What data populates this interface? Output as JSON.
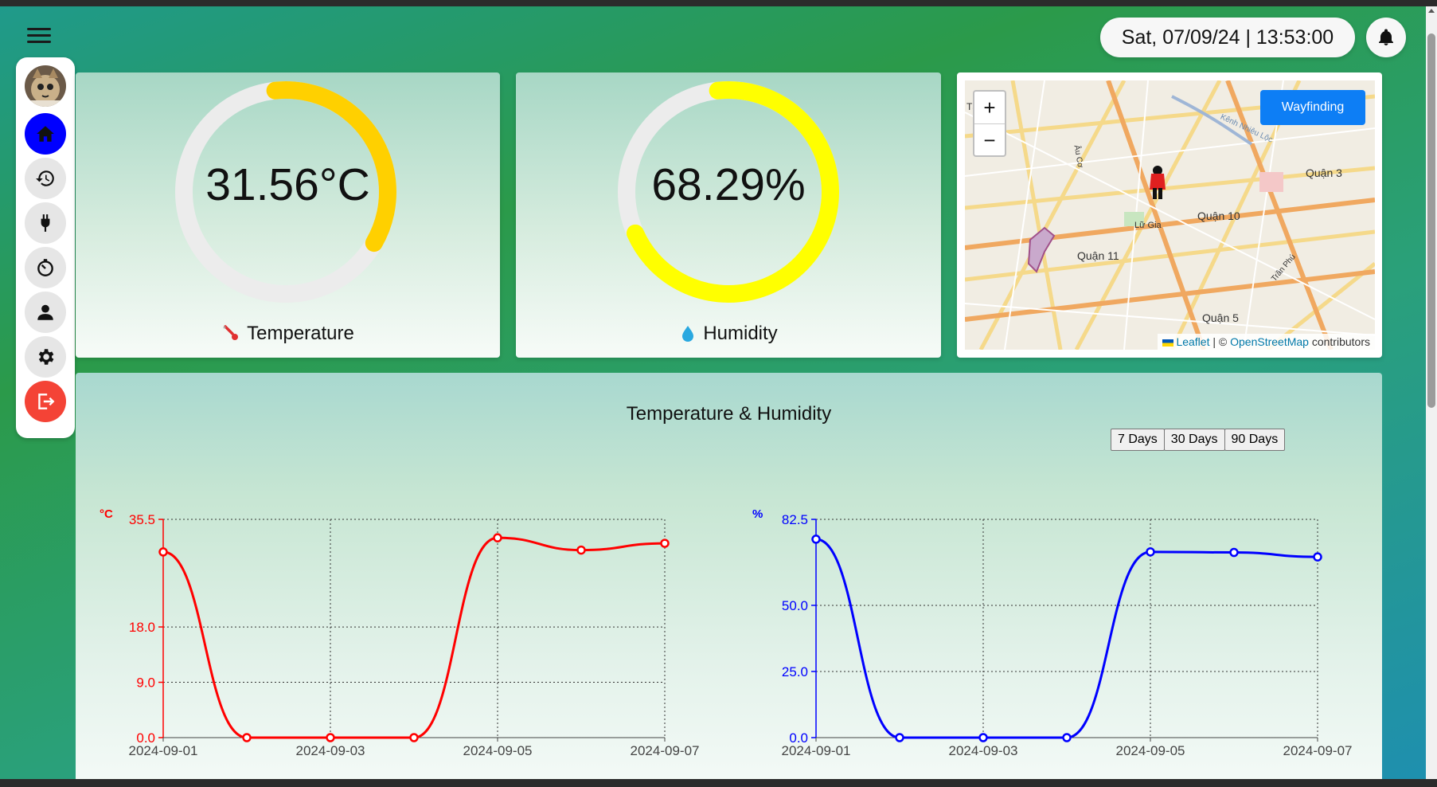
{
  "header": {
    "datetime": "Sat, 07/09/24  |  13:53:00"
  },
  "sidebar": {
    "items": [
      {
        "name": "home-icon",
        "active": true
      },
      {
        "name": "history-icon"
      },
      {
        "name": "plug-icon"
      },
      {
        "name": "timer-icon"
      },
      {
        "name": "user-icon"
      },
      {
        "name": "gear-icon"
      },
      {
        "name": "logout-icon"
      }
    ]
  },
  "temperature": {
    "value": "31.56°C",
    "label": "Temperature",
    "fill": 0.35,
    "color": "#ffd000"
  },
  "humidity": {
    "value": "68.29%",
    "label": "Humidity",
    "fill": 0.7,
    "color": "#ffff00"
  },
  "map": {
    "wayfinding_label": "Wayfinding",
    "zoom_in": "+",
    "zoom_out": "−",
    "attribution_leaflet": "Leaflet",
    "attribution_sep": "| ©",
    "attribution_osm": "OpenStreetMap",
    "attribution_tail": "contributors",
    "labels": [
      "Quận 3",
      "Quận 10",
      "Quận 11",
      "Quận 5",
      "Lữ Gia",
      "Trần Phú",
      "Âu Cơ",
      "Kênh Nhiêu Lộc",
      "Tâ"
    ]
  },
  "chart_section": {
    "title": "Temperature & Humidity",
    "range_buttons": [
      "7 Days",
      "30 Days",
      "90 Days"
    ]
  },
  "chart_data": [
    {
      "type": "line",
      "ylabel": "°C",
      "x": [
        "2024-09-01",
        "2024-09-02",
        "2024-09-03",
        "2024-09-04",
        "2024-09-05",
        "2024-09-06",
        "2024-09-07"
      ],
      "x_tick_labels": [
        "2024-09-01",
        "2024-09-03",
        "2024-09-05",
        "2024-09-07"
      ],
      "y_ticks": [
        0.0,
        9.0,
        18.0,
        35.5
      ],
      "y_tick_labels": [
        "0.0",
        "9.0",
        "18.0",
        "35.5"
      ],
      "ylim": [
        0,
        35.5
      ],
      "series": [
        {
          "values": [
            30.2,
            0.0,
            0.0,
            0.0,
            32.5,
            30.5,
            31.6
          ],
          "color": "#ff0000"
        }
      ],
      "grid": true
    },
    {
      "type": "line",
      "ylabel": "%",
      "x": [
        "2024-09-01",
        "2024-09-02",
        "2024-09-03",
        "2024-09-04",
        "2024-09-05",
        "2024-09-06",
        "2024-09-07"
      ],
      "x_tick_labels": [
        "2024-09-01",
        "2024-09-03",
        "2024-09-05",
        "2024-09-07"
      ],
      "y_ticks": [
        0.0,
        25.0,
        50.0,
        82.5
      ],
      "y_tick_labels": [
        "0.0",
        "25.0",
        "50.0",
        "82.5"
      ],
      "ylim": [
        0,
        82.5
      ],
      "series": [
        {
          "values": [
            75.0,
            0.0,
            0.0,
            0.0,
            70.2,
            70.0,
            68.3
          ],
          "color": "#0000ff"
        }
      ],
      "grid": true
    }
  ]
}
